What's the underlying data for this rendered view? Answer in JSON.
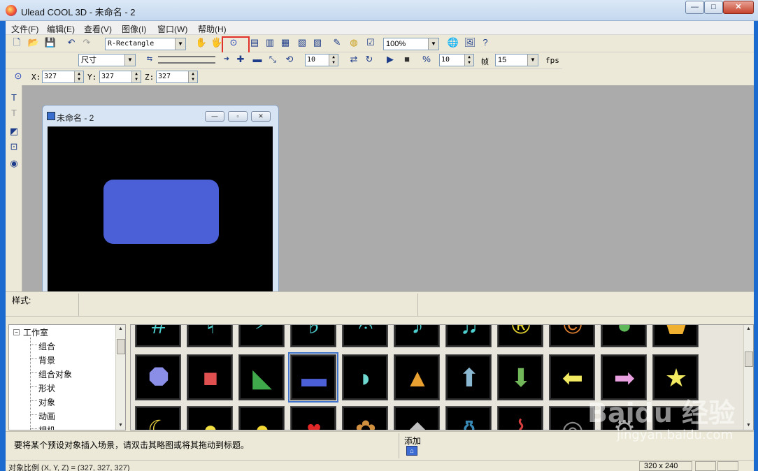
{
  "window": {
    "title": "Ulead COOL 3D - 未命名 - 2",
    "min": "—",
    "max": "□",
    "close": "✕"
  },
  "menu": [
    "文件(F)",
    "编辑(E)",
    "查看(V)",
    "图像(I)",
    "窗口(W)",
    "帮助(H)"
  ],
  "toolbar1": {
    "object_select": "R-Rectangle",
    "zoom": "100%"
  },
  "toolbar2": {
    "attr_select": "尺寸",
    "value_a": "10",
    "value_b": "10",
    "frame_label": "帧",
    "frames": "15",
    "fps_label": "fps"
  },
  "toolbar3": {
    "x_label": "X:",
    "x": "327",
    "y_label": "Y:",
    "y": "327",
    "z_label": "Z:",
    "z": "327"
  },
  "document": {
    "title": "未命名 - 2",
    "min": "—",
    "max": "▫",
    "close": "✕",
    "shape_color": "#4b5fd6"
  },
  "style_bar": {
    "label": "样式:"
  },
  "tree": {
    "root": "工作室",
    "items": [
      "组合",
      "背景",
      "组合对象",
      "形状",
      "对象",
      "动画",
      "相机"
    ]
  },
  "thumbnails": {
    "row1": [
      "#",
      "♮",
      "𝄢",
      "♭",
      "𝄐",
      "♪",
      "♫",
      "®",
      "©",
      "●",
      "⬟"
    ],
    "row2": [
      "⯃",
      "■",
      "◣",
      "▬",
      "◗",
      "▲",
      "⬆",
      "⬇",
      "⬅",
      "➡",
      "★"
    ],
    "row3": [
      "☾",
      "●",
      "●",
      "♥",
      "✿",
      "◆",
      "⚱",
      "⌇",
      "◎",
      "⚙",
      ""
    ],
    "row2_colors": [
      "#8a8ee6",
      "#e05050",
      "#3fa84a",
      "#4b5fd6",
      "#6fd8d0",
      "#e8a030",
      "#8ab8d0",
      "#72b85a",
      "#f2ea60",
      "#e8a0e0",
      "#f2ea60"
    ],
    "row1_colors": [
      "#4fd0d0",
      "#4fd0d0",
      "#4fd0d0",
      "#4fd0d0",
      "#4fd0d0",
      "#4fd0d0",
      "#4fd0d0",
      "#e8d830",
      "#e08030",
      "#5fb85a",
      "#f0b030"
    ],
    "row3_colors": [
      "#e8d040",
      "#f2e040",
      "#f2d830",
      "#e02828",
      "#d09040",
      "#c0c0c0",
      "#3a8ab8",
      "#d84040",
      "#888888",
      "#aaaaaa",
      "#000"
    ]
  },
  "hint": {
    "text": "要将某个预设对象插入场景，请双击其略图或将其拖动到标题。",
    "add_label": "添加"
  },
  "status": {
    "scale": "对象比例 (X, Y, Z) = (327, 327, 327)",
    "size": "320 x 240"
  },
  "watermark": {
    "brand": "Baidu 经验",
    "url": "jingyan.baidu.com"
  }
}
